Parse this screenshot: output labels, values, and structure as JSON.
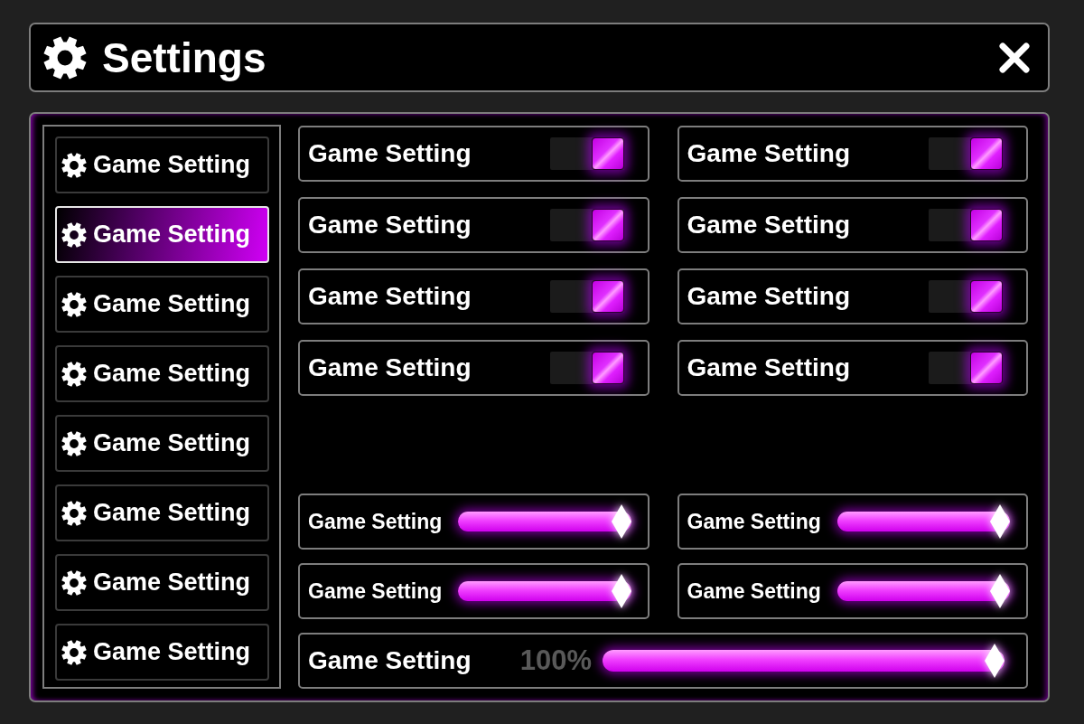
{
  "window": {
    "title": "Settings"
  },
  "sidebar": {
    "items": [
      {
        "label": "Game Setting",
        "selected": false
      },
      {
        "label": "Game Setting",
        "selected": true
      },
      {
        "label": "Game Setting",
        "selected": false
      },
      {
        "label": "Game Setting",
        "selected": false
      },
      {
        "label": "Game Setting",
        "selected": false
      },
      {
        "label": "Game Setting",
        "selected": false
      },
      {
        "label": "Game Setting",
        "selected": false
      },
      {
        "label": "Game Setting",
        "selected": false
      }
    ]
  },
  "toggles": [
    {
      "label": "Game Setting",
      "on": true
    },
    {
      "label": "Game Setting",
      "on": true
    },
    {
      "label": "Game Setting",
      "on": true
    },
    {
      "label": "Game Setting",
      "on": true
    },
    {
      "label": "Game Setting",
      "on": true
    },
    {
      "label": "Game Setting",
      "on": true
    },
    {
      "label": "Game Setting",
      "on": true
    },
    {
      "label": "Game Setting",
      "on": true
    }
  ],
  "sliders": [
    {
      "label": "Game Setting",
      "level": 1
    },
    {
      "label": "Game Setting",
      "level": 1
    },
    {
      "label": "Game Setting",
      "level": 1
    },
    {
      "label": "Game Setting",
      "level": 1
    }
  ],
  "main_slider": {
    "label": "Game Setting",
    "reading": "100%",
    "level": 1
  }
}
